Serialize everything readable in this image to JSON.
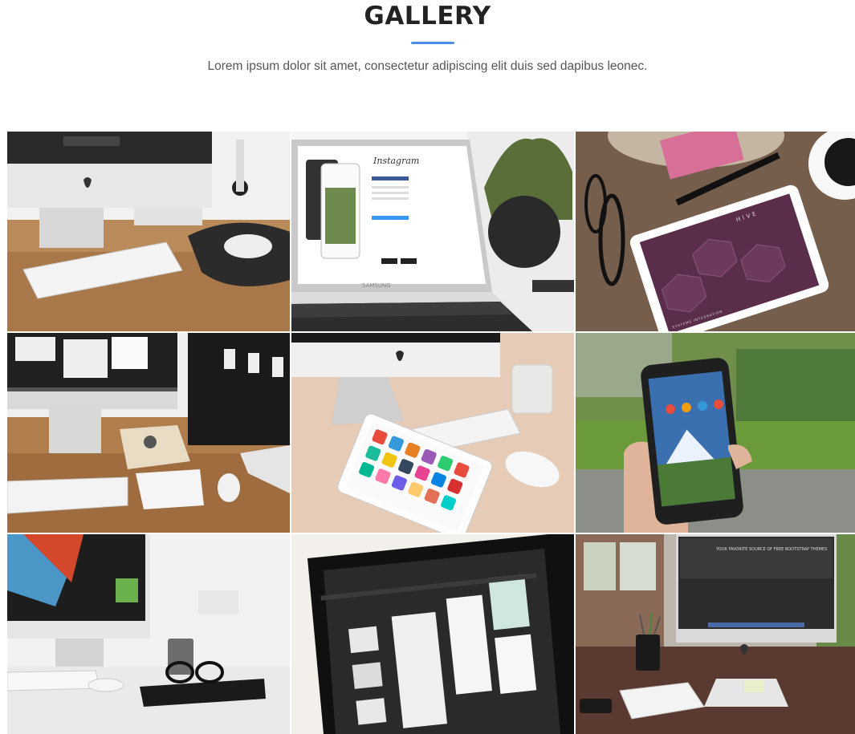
{
  "section": {
    "title": "GALLERY",
    "subtitle": "Lorem ipsum dolor sit amet, consectetur adipiscing elit duis sed dapibus leonec."
  },
  "gallery": {
    "items": [
      {
        "name": "imac-keyboard-desk-photo"
      },
      {
        "name": "laptop-instagram-photo",
        "screen_text": "Instagram",
        "laptop_brand": "SAMSUNG"
      },
      {
        "name": "tablet-glasses-pen-photo",
        "screen_text": "HIVE",
        "screen_caption": "SYSTEMS INTEGRATION"
      },
      {
        "name": "imac-notebook-desk-photo"
      },
      {
        "name": "imac-tablet-apps-photo"
      },
      {
        "name": "hand-smartphone-photo"
      },
      {
        "name": "imac-mug-glasses-photo"
      },
      {
        "name": "monitor-design-closeup-photo"
      },
      {
        "name": "imac-pencil-cup-photo",
        "screen_text": "YOUR FAVORITE SOURCE OF FREE BOOTSTRAP THEMES"
      }
    ]
  }
}
